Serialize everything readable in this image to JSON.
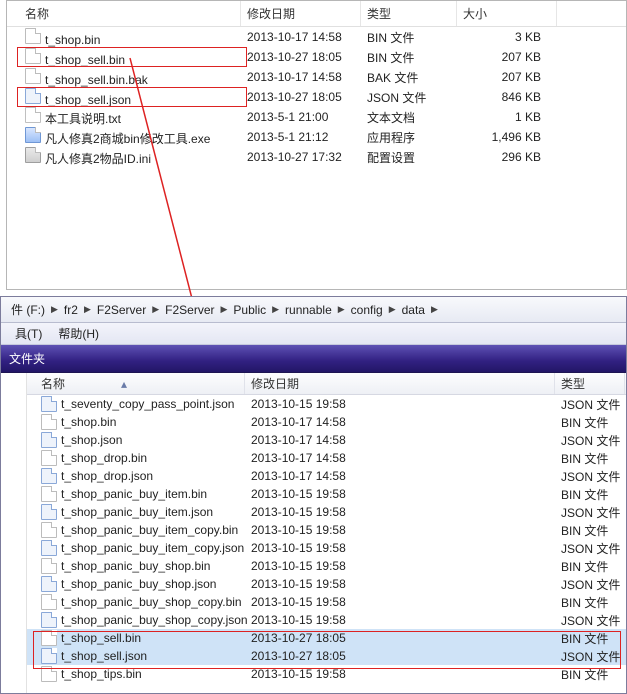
{
  "top": {
    "headers": {
      "name": "名称",
      "date": "修改日期",
      "type": "类型",
      "size": "大小"
    },
    "files": [
      {
        "icon": "file",
        "name": "t_shop.bin",
        "date": "2013-10-17 14:58",
        "type": "BIN 文件",
        "size": "3 KB"
      },
      {
        "icon": "file",
        "name": "t_shop_sell.bin",
        "date": "2013-10-27 18:05",
        "type": "BIN 文件",
        "size": "207 KB"
      },
      {
        "icon": "file",
        "name": "t_shop_sell.bin.bak",
        "date": "2013-10-17 14:58",
        "type": "BAK 文件",
        "size": "207 KB"
      },
      {
        "icon": "json",
        "name": "t_shop_sell.json",
        "date": "2013-10-27 18:05",
        "type": "JSON 文件",
        "size": "846 KB"
      },
      {
        "icon": "txt",
        "name": "本工具说明.txt",
        "date": "2013-5-1 21:00",
        "type": "文本文档",
        "size": "1 KB"
      },
      {
        "icon": "exe",
        "name": "凡人修真2商城bin修改工具.exe",
        "date": "2013-5-1 21:12",
        "type": "应用程序",
        "size": "1,496 KB"
      },
      {
        "icon": "ini",
        "name": "凡人修真2物品ID.ini",
        "date": "2013-10-27 17:32",
        "type": "配置设置",
        "size": "296 KB"
      }
    ]
  },
  "bottom": {
    "breadcrumb": [
      "件 (F:)",
      "fr2",
      "F2Server",
      "F2Server",
      "Public",
      "runnable",
      "config",
      "data"
    ],
    "menu": {
      "tools": "具(T)",
      "help": "帮助(H)"
    },
    "toolbar_label": "文件夹",
    "headers": {
      "name": "名称",
      "date": "修改日期",
      "type": "类型"
    },
    "files": [
      {
        "icon": "json",
        "name": "t_seventy_copy_pass_point.json",
        "date": "2013-10-15 19:58",
        "type": "JSON 文件",
        "hl": false
      },
      {
        "icon": "file",
        "name": "t_shop.bin",
        "date": "2013-10-17 14:58",
        "type": "BIN 文件",
        "hl": false
      },
      {
        "icon": "json",
        "name": "t_shop.json",
        "date": "2013-10-17 14:58",
        "type": "JSON 文件",
        "hl": false
      },
      {
        "icon": "file",
        "name": "t_shop_drop.bin",
        "date": "2013-10-17 14:58",
        "type": "BIN 文件",
        "hl": false
      },
      {
        "icon": "json",
        "name": "t_shop_drop.json",
        "date": "2013-10-17 14:58",
        "type": "JSON 文件",
        "hl": false
      },
      {
        "icon": "file",
        "name": "t_shop_panic_buy_item.bin",
        "date": "2013-10-15 19:58",
        "type": "BIN 文件",
        "hl": false
      },
      {
        "icon": "json",
        "name": "t_shop_panic_buy_item.json",
        "date": "2013-10-15 19:58",
        "type": "JSON 文件",
        "hl": false
      },
      {
        "icon": "file",
        "name": "t_shop_panic_buy_item_copy.bin",
        "date": "2013-10-15 19:58",
        "type": "BIN 文件",
        "hl": false
      },
      {
        "icon": "json",
        "name": "t_shop_panic_buy_item_copy.json",
        "date": "2013-10-15 19:58",
        "type": "JSON 文件",
        "hl": false
      },
      {
        "icon": "file",
        "name": "t_shop_panic_buy_shop.bin",
        "date": "2013-10-15 19:58",
        "type": "BIN 文件",
        "hl": false
      },
      {
        "icon": "json",
        "name": "t_shop_panic_buy_shop.json",
        "date": "2013-10-15 19:58",
        "type": "JSON 文件",
        "hl": false
      },
      {
        "icon": "file",
        "name": "t_shop_panic_buy_shop_copy.bin",
        "date": "2013-10-15 19:58",
        "type": "BIN 文件",
        "hl": false
      },
      {
        "icon": "json",
        "name": "t_shop_panic_buy_shop_copy.json",
        "date": "2013-10-15 19:58",
        "type": "JSON 文件",
        "hl": false
      },
      {
        "icon": "file",
        "name": "t_shop_sell.bin",
        "date": "2013-10-27 18:05",
        "type": "BIN 文件",
        "hl": true
      },
      {
        "icon": "json",
        "name": "t_shop_sell.json",
        "date": "2013-10-27 18:05",
        "type": "JSON 文件",
        "hl": true
      },
      {
        "icon": "file",
        "name": "t_shop_tips.bin",
        "date": "2013-10-15 19:58",
        "type": "BIN 文件",
        "hl": false
      }
    ]
  }
}
